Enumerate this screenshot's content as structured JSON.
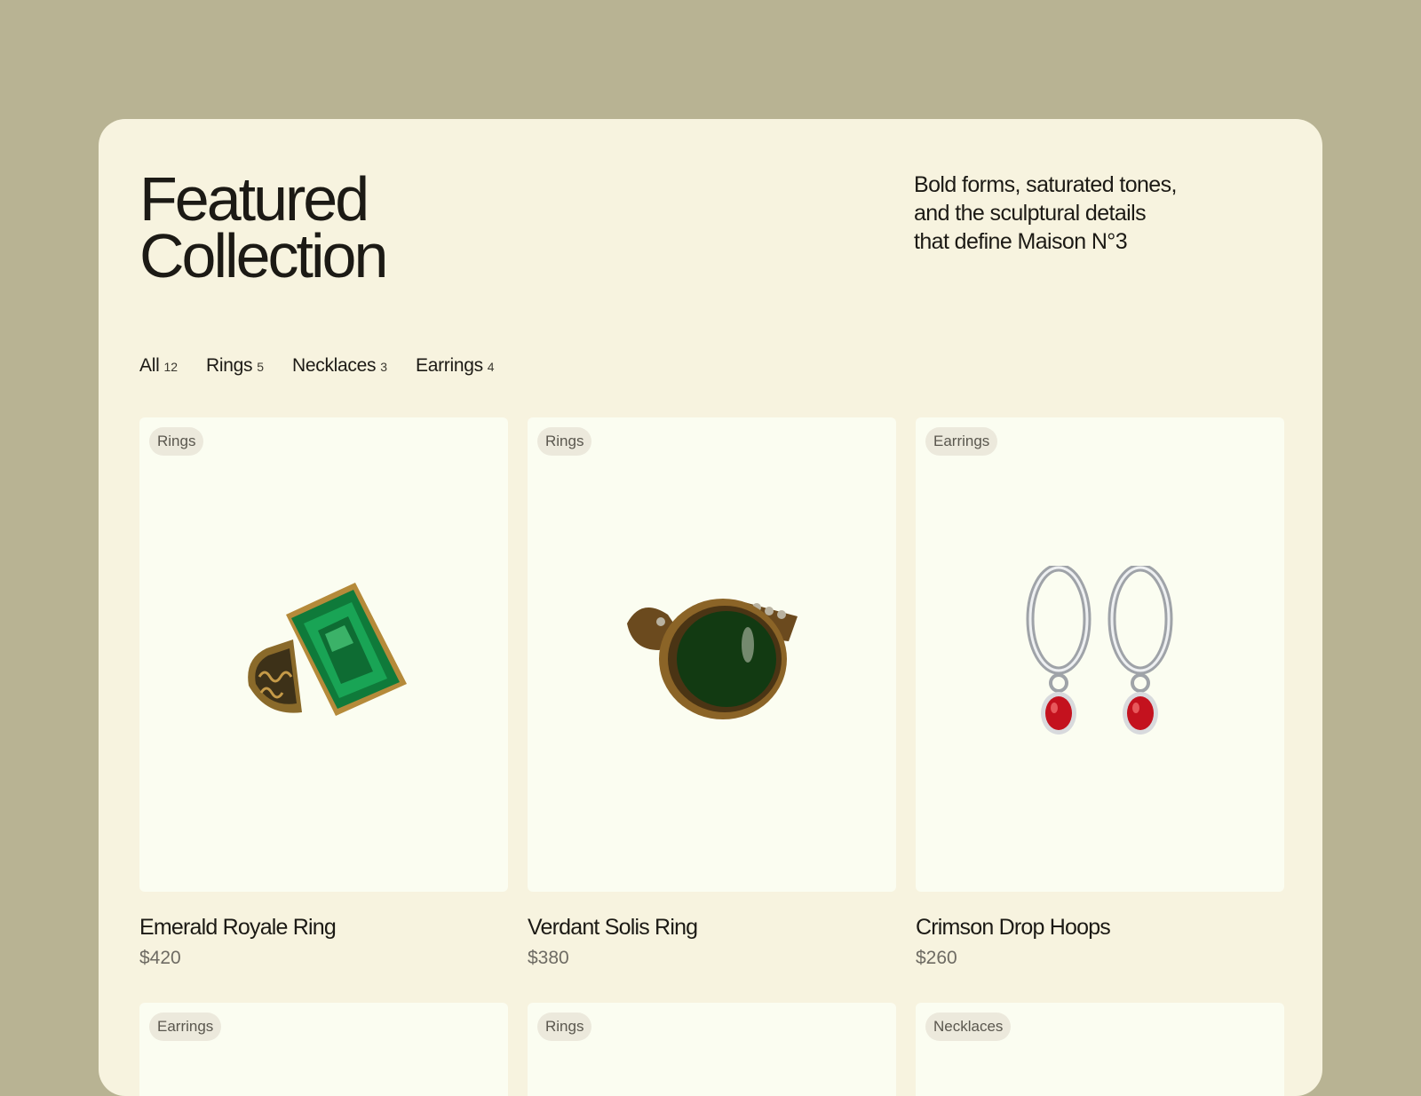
{
  "header": {
    "title_line1": "Featured",
    "title_line2": "Collection",
    "tagline_line1": "Bold forms, saturated tones,",
    "tagline_line2": "and the sculptural details",
    "tagline_line3": "that define Maison N°3"
  },
  "filters": [
    {
      "label": "All",
      "count": "12"
    },
    {
      "label": "Rings",
      "count": "5"
    },
    {
      "label": "Necklaces",
      "count": "3"
    },
    {
      "label": "Earrings",
      "count": "4"
    }
  ],
  "products": [
    {
      "tag": "Rings",
      "name": "Emerald Royale Ring",
      "price": "$420",
      "image": "emerald-ring-image"
    },
    {
      "tag": "Rings",
      "name": "Verdant Solis Ring",
      "price": "$380",
      "image": "green-cabochon-ring-image"
    },
    {
      "tag": "Earrings",
      "name": "Crimson Drop Hoops",
      "price": "$260",
      "image": "red-drop-hoop-earrings-image"
    },
    {
      "tag": "Earrings"
    },
    {
      "tag": "Rings"
    },
    {
      "tag": "Necklaces"
    }
  ],
  "colors": {
    "background": "#b8b393",
    "panel": "#f7f3df",
    "card": "#fbfdf1",
    "tag_bg": "#ece9dc"
  }
}
